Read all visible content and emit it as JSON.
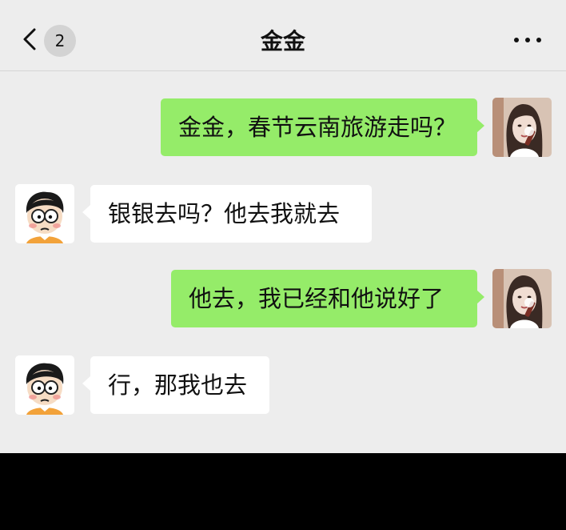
{
  "header": {
    "back_icon": "chevron-left-icon",
    "unread_count": "2",
    "title": "金金",
    "more_icon": "more-horizontal-icon"
  },
  "messages": [
    {
      "side": "out",
      "sender": "me",
      "text": "金金，春节云南旅游走吗？"
    },
    {
      "side": "in",
      "sender": "contact",
      "text": "银银去吗？他去我就去"
    },
    {
      "side": "out",
      "sender": "me",
      "text": "他去，我已经和他说好了"
    },
    {
      "side": "in",
      "sender": "contact",
      "text": "行，那我也去"
    }
  ],
  "colors": {
    "background": "#ededed",
    "outgoing_bubble": "#95ec69",
    "incoming_bubble": "#ffffff",
    "bottom_bar": "#000000"
  }
}
